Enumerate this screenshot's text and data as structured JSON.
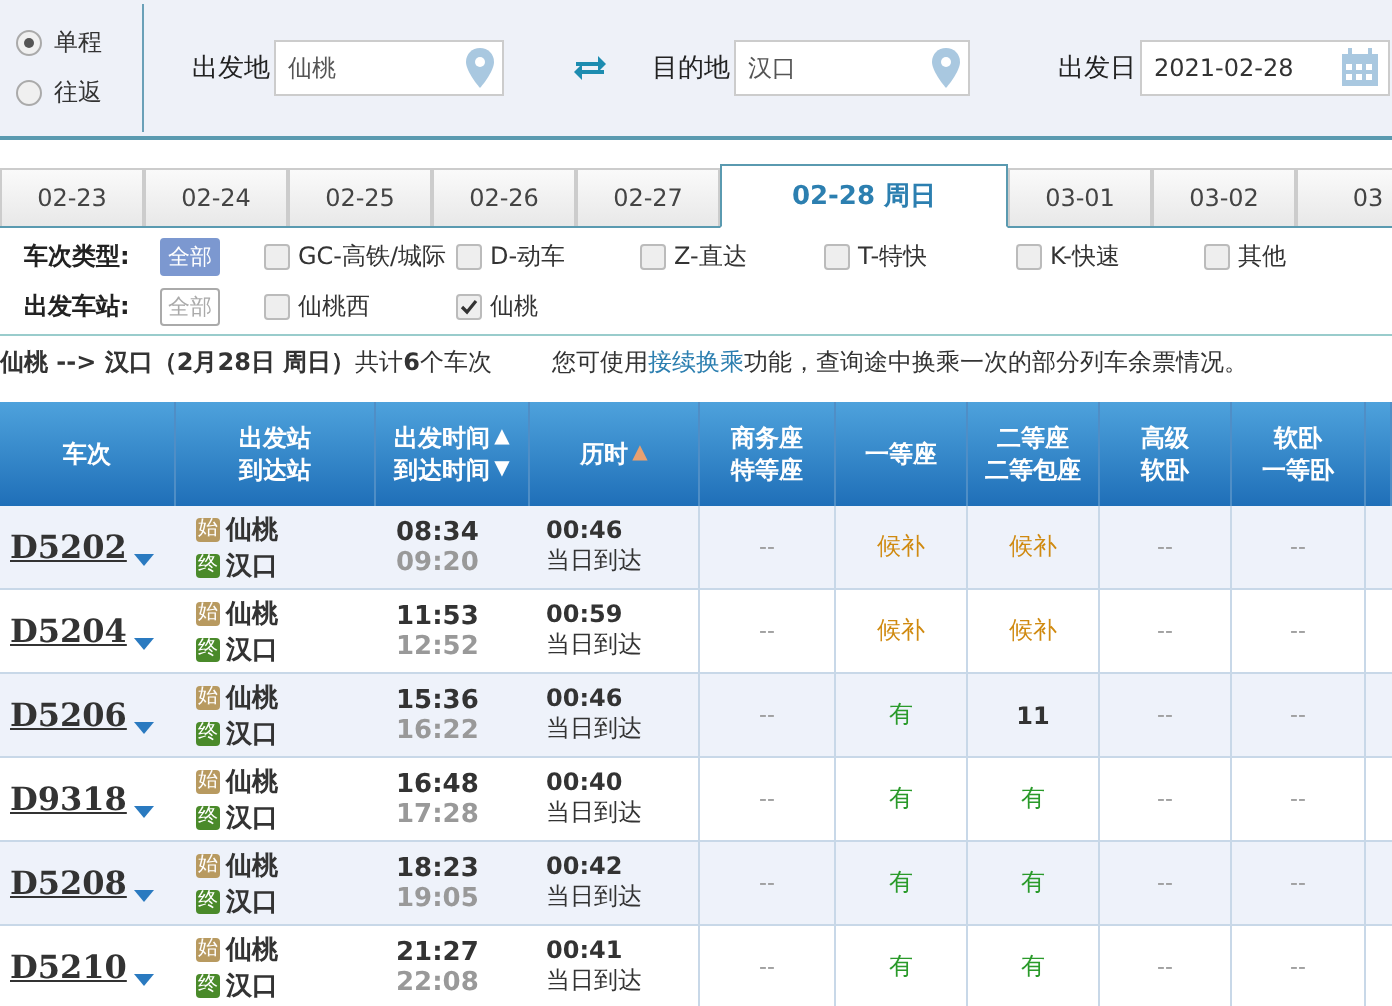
{
  "trip_type": [
    {
      "label": "单程",
      "selected": true
    },
    {
      "label": "往返",
      "selected": false
    }
  ],
  "search": {
    "from": {
      "label": "出发地",
      "value": "仙桃"
    },
    "to": {
      "label": "目的地",
      "value": "汉口"
    },
    "date": {
      "label": "出发日",
      "value": "2021-02-28"
    }
  },
  "date_tabs": [
    {
      "label": "02-23",
      "selected": false
    },
    {
      "label": "02-24",
      "selected": false
    },
    {
      "label": "02-25",
      "selected": false
    },
    {
      "label": "02-26",
      "selected": false
    },
    {
      "label": "02-27",
      "selected": false
    },
    {
      "label": "02-28 周日",
      "selected": true
    },
    {
      "label": "03-01",
      "selected": false
    },
    {
      "label": "03-02",
      "selected": false
    },
    {
      "label": "03",
      "selected": false
    }
  ],
  "filters": [
    {
      "label": "车次类型:",
      "all": {
        "label": "全部",
        "selected": true
      },
      "options": [
        {
          "label": "GC-高铁/城际",
          "checked": false
        },
        {
          "label": "D-动车",
          "checked": false
        },
        {
          "label": "Z-直达",
          "checked": false
        },
        {
          "label": "T-特快",
          "checked": false
        },
        {
          "label": "K-快速",
          "checked": false
        },
        {
          "label": "其他",
          "checked": false
        }
      ]
    },
    {
      "label": "出发车站:",
      "all": {
        "label": "全部",
        "selected": false
      },
      "options": [
        {
          "label": "仙桃西",
          "checked": false
        },
        {
          "label": "仙桃",
          "checked": true
        }
      ]
    }
  ],
  "summary": {
    "route": "**仙桃 --> 汉口（2月28日  周日）**共计**6**个车次",
    "notice_before": "您可使用",
    "notice_link": "接续换乘",
    "notice_after": "功能，查询途中换乘一次的部分列车余票情况。"
  },
  "columns": [
    {
      "lines": [
        {
          "text": "车次"
        }
      ]
    },
    {
      "lines": [
        {
          "text": "出发站"
        },
        {
          "text": "到达站"
        }
      ]
    },
    {
      "lines": [
        {
          "text": "出发时间",
          "arrow": "▲",
          "active": false
        },
        {
          "text": "到达时间",
          "arrow": "▼",
          "active": false
        }
      ]
    },
    {
      "lines": [
        {
          "text": "历时",
          "arrow": "▲",
          "active": true
        }
      ]
    },
    {
      "lines": [
        {
          "text": "商务座"
        },
        {
          "text": "特等座"
        }
      ]
    },
    {
      "lines": [
        {
          "text": "一等座"
        }
      ]
    },
    {
      "lines": [
        {
          "text": "二等座"
        },
        {
          "text": "二等包座"
        }
      ]
    },
    {
      "lines": [
        {
          "text": "高级"
        },
        {
          "text": "软卧"
        }
      ]
    },
    {
      "lines": [
        {
          "text": "软卧"
        },
        {
          "text": "一等卧"
        }
      ]
    }
  ],
  "rows": [
    {
      "train": "D5202",
      "from_tag": "始",
      "from": "仙桃",
      "to_tag": "终",
      "to": "汉口",
      "depart": "08:34",
      "arrive": "09:20",
      "duration": "00:46",
      "arrival_day": "当日到达",
      "seats": [
        {
          "text": "--",
          "kind": "none"
        },
        {
          "text": "候补",
          "kind": "waitlist"
        },
        {
          "text": "候补",
          "kind": "waitlist"
        },
        {
          "text": "--",
          "kind": "none"
        },
        {
          "text": "--",
          "kind": "none"
        }
      ]
    },
    {
      "train": "D5204",
      "from_tag": "始",
      "from": "仙桃",
      "to_tag": "终",
      "to": "汉口",
      "depart": "11:53",
      "arrive": "12:52",
      "duration": "00:59",
      "arrival_day": "当日到达",
      "seats": [
        {
          "text": "--",
          "kind": "none"
        },
        {
          "text": "候补",
          "kind": "waitlist"
        },
        {
          "text": "候补",
          "kind": "waitlist"
        },
        {
          "text": "--",
          "kind": "none"
        },
        {
          "text": "--",
          "kind": "none"
        }
      ]
    },
    {
      "train": "D5206",
      "from_tag": "始",
      "from": "仙桃",
      "to_tag": "终",
      "to": "汉口",
      "depart": "15:36",
      "arrive": "16:22",
      "duration": "00:46",
      "arrival_day": "当日到达",
      "seats": [
        {
          "text": "--",
          "kind": "none"
        },
        {
          "text": "有",
          "kind": "available"
        },
        {
          "text": "11",
          "kind": "count"
        },
        {
          "text": "--",
          "kind": "none"
        },
        {
          "text": "--",
          "kind": "none"
        }
      ]
    },
    {
      "train": "D9318",
      "from_tag": "始",
      "from": "仙桃",
      "to_tag": "终",
      "to": "汉口",
      "depart": "16:48",
      "arrive": "17:28",
      "duration": "00:40",
      "arrival_day": "当日到达",
      "seats": [
        {
          "text": "--",
          "kind": "none"
        },
        {
          "text": "有",
          "kind": "available"
        },
        {
          "text": "有",
          "kind": "available"
        },
        {
          "text": "--",
          "kind": "none"
        },
        {
          "text": "--",
          "kind": "none"
        }
      ]
    },
    {
      "train": "D5208",
      "from_tag": "始",
      "from": "仙桃",
      "to_tag": "终",
      "to": "汉口",
      "depart": "18:23",
      "arrive": "19:05",
      "duration": "00:42",
      "arrival_day": "当日到达",
      "seats": [
        {
          "text": "--",
          "kind": "none"
        },
        {
          "text": "有",
          "kind": "available"
        },
        {
          "text": "有",
          "kind": "available"
        },
        {
          "text": "--",
          "kind": "none"
        },
        {
          "text": "--",
          "kind": "none"
        }
      ]
    },
    {
      "train": "D5210",
      "from_tag": "始",
      "from": "仙桃",
      "to_tag": "终",
      "to": "汉口",
      "depart": "21:27",
      "arrive": "22:08",
      "duration": "00:41",
      "arrival_day": "当日到达",
      "seats": [
        {
          "text": "--",
          "kind": "none"
        },
        {
          "text": "有",
          "kind": "available"
        },
        {
          "text": "有",
          "kind": "available"
        },
        {
          "text": "--",
          "kind": "none"
        },
        {
          "text": "--",
          "kind": "none"
        }
      ]
    }
  ]
}
